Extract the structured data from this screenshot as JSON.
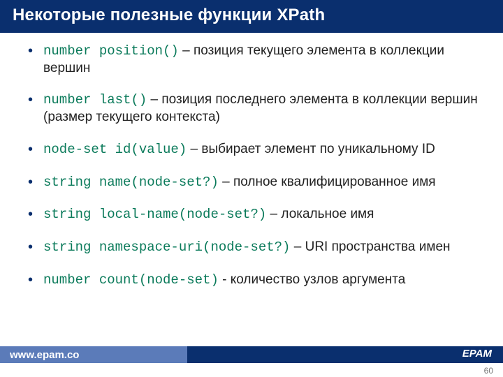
{
  "title": "Некоторые полезные функции XPath",
  "bullets": [
    {
      "code": "number position()",
      "sep": " – ",
      "desc": "позиция текущего элемента в коллекции вершин"
    },
    {
      "code": "number last()",
      "sep": " – ",
      "desc": "позиция последнего элемента в коллекции вершин (размер текущего контекста)"
    },
    {
      "code": "node-set id(value)",
      "sep": " – ",
      "desc": "выбирает элемент по уникальному ID"
    },
    {
      "code": "string name(node-set?)",
      "sep": " – ",
      "desc": "полное квалифицированное имя"
    },
    {
      "code": "string local-name(node-set?)",
      "sep": " – ",
      "desc": "локальное имя"
    },
    {
      "code": "string namespace-uri(node-set?)",
      "sep": " – ",
      "desc": "URI пространства имен"
    },
    {
      "code": "number count(node-set)",
      "sep": " - ",
      "desc": "количество узлов аргумента"
    }
  ],
  "footer": {
    "url": "www.epam.co",
    "brand": "EPAM"
  },
  "page_number": "60"
}
